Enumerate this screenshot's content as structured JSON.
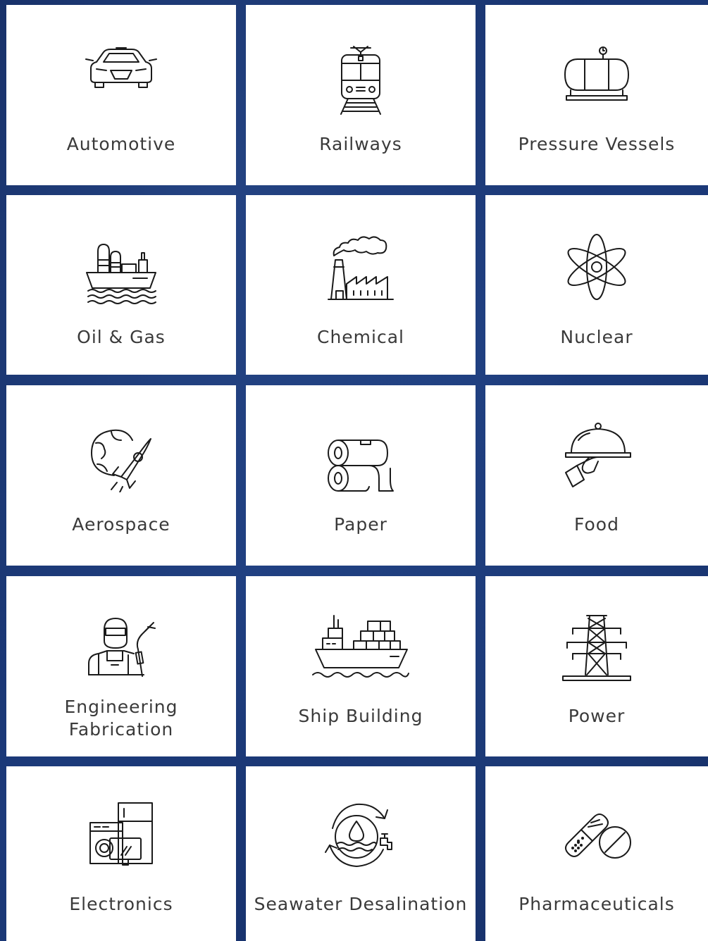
{
  "industries": [
    {
      "label": "Automotive",
      "icon": "car-icon"
    },
    {
      "label": "Railways",
      "icon": "train-icon"
    },
    {
      "label": "Pressure Vessels",
      "icon": "pressure-tank-icon"
    },
    {
      "label": "Oil & Gas",
      "icon": "oil-tanker-icon"
    },
    {
      "label": "Chemical",
      "icon": "factory-icon"
    },
    {
      "label": "Nuclear",
      "icon": "atom-icon"
    },
    {
      "label": "Aerospace",
      "icon": "rocket-globe-icon"
    },
    {
      "label": "Paper",
      "icon": "paper-roll-icon"
    },
    {
      "label": "Food",
      "icon": "cloche-icon"
    },
    {
      "label": "Engineering\nFabrication",
      "icon": "welder-icon"
    },
    {
      "label": "Ship Building",
      "icon": "cargo-ship-icon"
    },
    {
      "label": "Power",
      "icon": "power-tower-icon"
    },
    {
      "label": "Electronics",
      "icon": "appliances-icon"
    },
    {
      "label": "Seawater Desalination",
      "icon": "water-cycle-icon"
    },
    {
      "label": "Pharmaceuticals",
      "icon": "pills-icon"
    }
  ]
}
